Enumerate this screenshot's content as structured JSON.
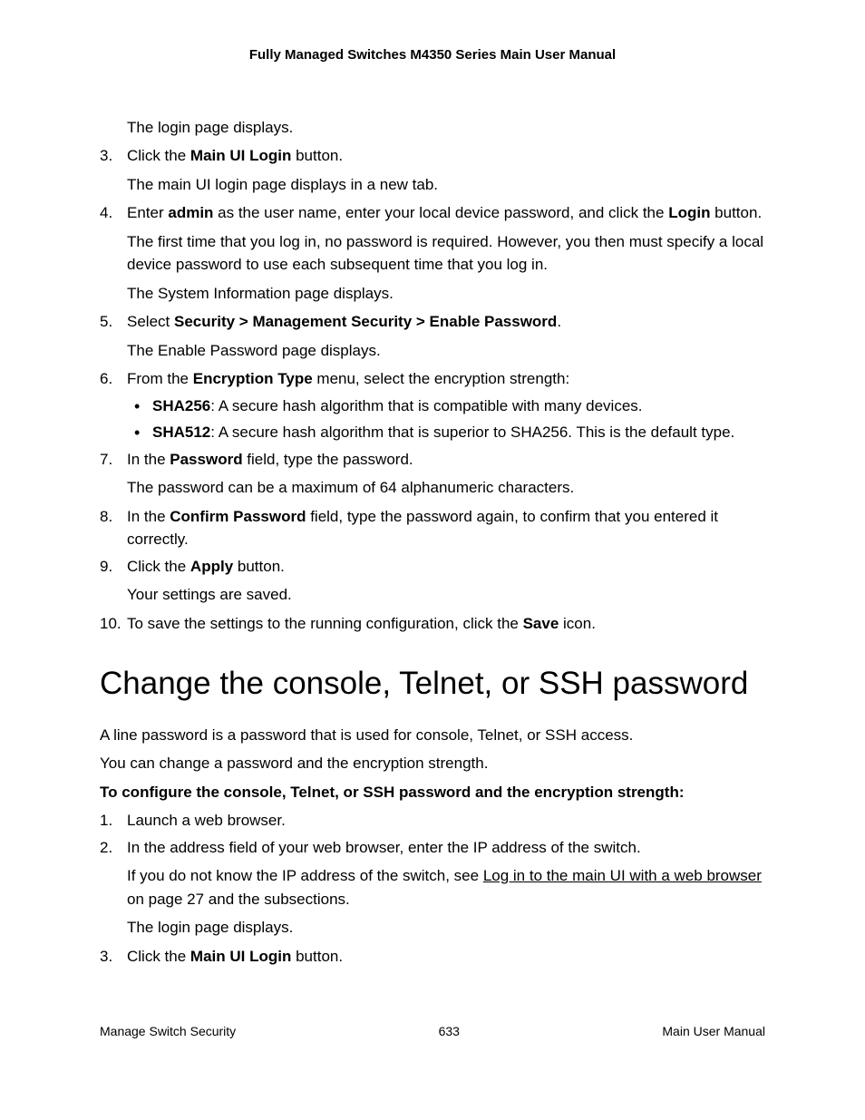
{
  "header": "Fully Managed Switches M4350 Series Main User Manual",
  "steps1": {
    "s2_result": "The login page displays.",
    "s3_num": "3.",
    "s3_text_a": "Click the ",
    "s3_bold": "Main UI Login",
    "s3_text_b": " button.",
    "s3_result": "The main UI login page displays in a new tab.",
    "s4_num": "4.",
    "s4_text_a": "Enter ",
    "s4_bold1": "admin",
    "s4_text_b": " as the user name, enter your local device password, and click the ",
    "s4_bold2": "Login",
    "s4_text_c": " button.",
    "s4_p1": "The first time that you log in, no password is required. However, you then must specify a local device password to use each subsequent time that you log in.",
    "s4_p2": "The System Information page displays.",
    "s5_num": "5.",
    "s5_text_a": "Select ",
    "s5_bold": "Security > Management Security > Enable Password",
    "s5_text_b": ".",
    "s5_p1": "The Enable Password page displays.",
    "s6_num": "6.",
    "s6_text_a": "From the ",
    "s6_bold": "Encryption Type",
    "s6_text_b": " menu, select the encryption strength:",
    "s6_b1_bold": "SHA256",
    "s6_b1_text": ": A secure hash algorithm that is compatible with many devices.",
    "s6_b2_bold": "SHA512",
    "s6_b2_text": ": A secure hash algorithm that is superior to SHA256. This is the default type.",
    "s7_num": "7.",
    "s7_text_a": "In the ",
    "s7_bold": "Password",
    "s7_text_b": " field, type the password.",
    "s7_p1": "The password can be a maximum of 64 alphanumeric characters.",
    "s8_num": "8.",
    "s8_text_a": "In the ",
    "s8_bold": "Confirm Password",
    "s8_text_b": " field, type the password again, to confirm that you entered it correctly.",
    "s9_num": "9.",
    "s9_text_a": "Click the ",
    "s9_bold": "Apply",
    "s9_text_b": " button.",
    "s9_p1": "Your settings are saved.",
    "s10_num": "10.",
    "s10_text_a": "To save the settings to the running configuration, click the ",
    "s10_bold": "Save",
    "s10_text_b": " icon."
  },
  "section_heading": "Change the console, Telnet, or SSH password",
  "section_p1": "A line password is a password that is used for console, Telnet, or SSH access.",
  "section_p2": "You can change a password and the encryption strength.",
  "section_lead": "To configure the console, Telnet, or SSH password and the encryption strength:",
  "steps2": {
    "s1_num": "1.",
    "s1_text": "Launch a web browser.",
    "s2_num": "2.",
    "s2_text": "In the address field of your web browser, enter the IP address of the switch.",
    "s2_p1_a": "If you do not know the IP address of the switch, see ",
    "s2_link": "Log in to the main UI with a web browser",
    "s2_p1_b": " on page 27 and the subsections.",
    "s2_p2": "The login page displays.",
    "s3_num": "3.",
    "s3_text_a": "Click the ",
    "s3_bold": "Main UI Login",
    "s3_text_b": " button."
  },
  "footer": {
    "left": "Manage Switch Security",
    "center": "633",
    "right": "Main User Manual"
  }
}
